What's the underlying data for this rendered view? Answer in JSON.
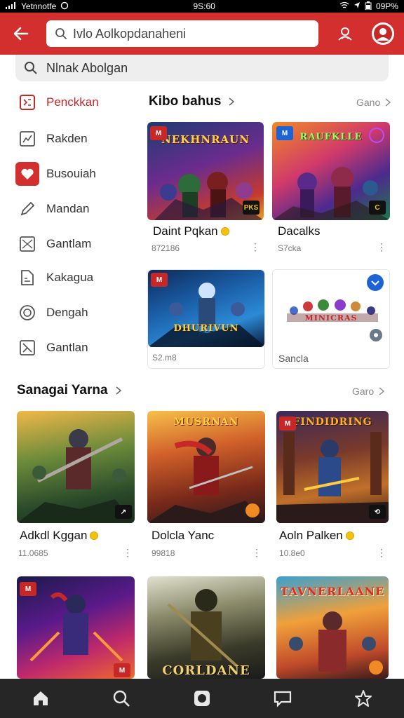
{
  "status": {
    "carrier": "Yetnnotfe",
    "time": "9S:60",
    "battery": "09P%"
  },
  "header": {
    "search_text": "Ivlo Aolkopdanaheni"
  },
  "subsearch": {
    "text": "Nlnak Abolgan"
  },
  "sidebar": {
    "items": [
      {
        "label": "Penckkan",
        "icon": "grid-icon",
        "active": true
      },
      {
        "label": "Rakden",
        "icon": "chart-icon"
      },
      {
        "label": "Busouiah",
        "icon": "heart-icon"
      },
      {
        "label": "Mandan",
        "icon": "pencil-icon"
      },
      {
        "label": "Gantlam",
        "icon": "image-icon"
      },
      {
        "label": "Kakagua",
        "icon": "document-icon"
      },
      {
        "label": "Dengah",
        "icon": "target-icon"
      },
      {
        "label": "Gantlan",
        "icon": "crossed-box-icon"
      }
    ]
  },
  "featured": {
    "title": "Kibo bahus",
    "more": "Gano",
    "cards": [
      {
        "art_title": "NEKHNRAUN",
        "title": "Daint Pqkan",
        "meta": "872186",
        "coin": true,
        "badge": "PKS"
      },
      {
        "art_title": "RAUFKLLE",
        "title": "Dacalks",
        "meta": "S7cka",
        "coin": false,
        "badge": "C"
      },
      {
        "art_title": "DHURIVUN",
        "title": "",
        "meta": "S2.m8",
        "coin": false,
        "badge": ""
      },
      {
        "art_title": "MINICRAS",
        "title": "",
        "meta": "Sancla",
        "coin": false,
        "badge": ""
      }
    ]
  },
  "section2": {
    "title": "Sanagai Yarna",
    "more": "Garo",
    "cards": [
      {
        "art_title": "",
        "title": "Adkdl Kggan",
        "meta": "11.0685",
        "coin": true
      },
      {
        "art_title": "MUSRNAN",
        "title": "Dolcla Yanc",
        "meta": "99818",
        "coin": false
      },
      {
        "art_title": "FINDIDRING",
        "title": "Aoln Palken",
        "meta": "10.8e0",
        "coin": true
      }
    ]
  },
  "section3": {
    "cards": [
      {
        "art_title": ""
      },
      {
        "art_title": "CORLDANE"
      },
      {
        "art_title": "TAVNERLAANE"
      }
    ]
  },
  "colors": {
    "brand": "#d32f2f",
    "accent_blue": "#1e63d6"
  },
  "bottom_nav": [
    "home-icon",
    "search-icon",
    "library-icon",
    "chat-icon",
    "star-icon"
  ]
}
